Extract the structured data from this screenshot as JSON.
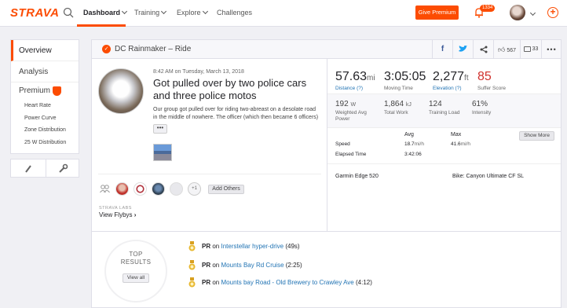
{
  "nav": {
    "logo": "STRAVA",
    "dashboard": "Dashboard",
    "training": "Training",
    "explore": "Explore",
    "challenges": "Challenges",
    "premium_button": "Give Premium",
    "notification_count": "1334"
  },
  "sidebar": {
    "items": [
      "Overview",
      "Analysis"
    ],
    "premium_label": "Premium",
    "sub_items": [
      "Heart Rate",
      "Power Curve",
      "Zone Distribution",
      "25 W Distribution"
    ]
  },
  "activity": {
    "header_title": "DC Rainmaker – Ride",
    "kudos_count": "567",
    "comment_count": "33",
    "time": "8:42 AM on Tuesday, March 13, 2018",
    "title": "Got pulled over by two police cars and three police motos",
    "description": "Our group got pulled over for riding two-abreast on a desolate road in the middle of nowhere. The officer (which then became 6 officers)",
    "more_label": "•••",
    "plus_count": "+1",
    "add_others": "Add Others",
    "labs_label": "STRAVA LABS",
    "flybys_label": "View Flybys"
  },
  "stats": {
    "distance": {
      "value": "57.63",
      "unit": "mi",
      "label": "Distance (?)"
    },
    "moving_time": {
      "value": "3:05:05",
      "label": "Moving Time"
    },
    "elevation": {
      "value": "2,277",
      "unit": "ft",
      "label": "Elevation (?)"
    },
    "suffer": {
      "value": "85",
      "label": "Suffer Score"
    },
    "weighted_power": {
      "value": "192",
      "unit": "W",
      "label": "Weighted Avg Power"
    },
    "total_work": {
      "value": "1,864",
      "unit": "kJ",
      "label": "Total Work"
    },
    "training_load": {
      "value": "124",
      "label": "Training Load"
    },
    "intensity": {
      "value": "61%",
      "label": "Intensity"
    },
    "show_more": "Show More",
    "table": {
      "col_avg": "Avg",
      "col_max": "Max",
      "speed_label": "Speed",
      "speed_avg": "18.7",
      "speed_max": "41.6",
      "speed_unit": "mi/h",
      "elapsed_label": "Elapsed Time",
      "elapsed_avg": "3:42:06"
    },
    "device": "Garmin Edge 520",
    "bike": "Bike: Canyon Ultimate CF SL"
  },
  "results": {
    "title_line1": "TOP",
    "title_line2": "RESULTS",
    "view_all": "View all",
    "items": [
      {
        "pr": "PR",
        "on": "on",
        "segment": "Interstellar hyper-drive",
        "time": "(49s)"
      },
      {
        "pr": "PR",
        "on": "on",
        "segment": "Mounts Bay Rd Cruise",
        "time": "(2:25)"
      },
      {
        "pr": "PR",
        "on": "on",
        "segment": "Mounts bay Road - Old Brewery to Crawley Ave",
        "time": "(4:12)"
      }
    ]
  },
  "colors": {
    "brand": "#fc4c02",
    "link": "#2274b4",
    "suffer": "#d0312d"
  }
}
